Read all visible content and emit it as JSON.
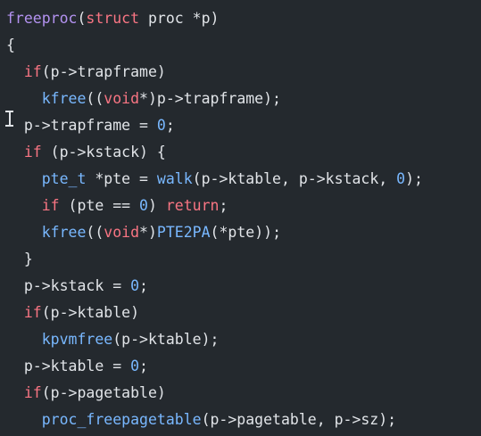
{
  "editor": {
    "colors": {
      "background": "#24292e",
      "text": "#e1e4e8",
      "keyword": "#f97583",
      "function_name": "#b392f0",
      "call": "#79b8ff",
      "number": "#79b8ff"
    },
    "cursor_icon": "text-cursor-ibeam-icon",
    "lines": [
      {
        "tokens": [
          {
            "c": "fn",
            "t": "freeproc"
          },
          {
            "c": "",
            "t": "("
          },
          {
            "c": "kw",
            "t": "struct"
          },
          {
            "c": "",
            "t": " proc *p)"
          }
        ]
      },
      {
        "tokens": [
          {
            "c": "",
            "t": "{"
          }
        ]
      },
      {
        "tokens": [
          {
            "c": "",
            "t": "  "
          },
          {
            "c": "kw",
            "t": "if"
          },
          {
            "c": "",
            "t": "(p->trapframe)"
          }
        ]
      },
      {
        "tokens": [
          {
            "c": "",
            "t": "    "
          },
          {
            "c": "call",
            "t": "kfree"
          },
          {
            "c": "",
            "t": "(("
          },
          {
            "c": "kw",
            "t": "void"
          },
          {
            "c": "",
            "t": "*)p->trapframe);"
          }
        ]
      },
      {
        "tokens": [
          {
            "c": "",
            "t": "  p->trapframe = "
          },
          {
            "c": "num",
            "t": "0"
          },
          {
            "c": "",
            "t": ";"
          }
        ]
      },
      {
        "tokens": [
          {
            "c": "",
            "t": "  "
          },
          {
            "c": "kw",
            "t": "if"
          },
          {
            "c": "",
            "t": " (p->kstack) {"
          }
        ]
      },
      {
        "tokens": [
          {
            "c": "",
            "t": "    "
          },
          {
            "c": "ty",
            "t": "pte_t"
          },
          {
            "c": "",
            "t": " *pte = "
          },
          {
            "c": "call",
            "t": "walk"
          },
          {
            "c": "",
            "t": "(p->ktable, p->kstack, "
          },
          {
            "c": "num",
            "t": "0"
          },
          {
            "c": "",
            "t": ");"
          }
        ]
      },
      {
        "tokens": [
          {
            "c": "",
            "t": "    "
          },
          {
            "c": "kw",
            "t": "if"
          },
          {
            "c": "",
            "t": " (pte == "
          },
          {
            "c": "num",
            "t": "0"
          },
          {
            "c": "",
            "t": ") "
          },
          {
            "c": "kw",
            "t": "return"
          },
          {
            "c": "",
            "t": ";"
          }
        ]
      },
      {
        "tokens": [
          {
            "c": "",
            "t": "    "
          },
          {
            "c": "call",
            "t": "kfree"
          },
          {
            "c": "",
            "t": "(("
          },
          {
            "c": "kw",
            "t": "void"
          },
          {
            "c": "",
            "t": "*)"
          },
          {
            "c": "call",
            "t": "PTE2PA"
          },
          {
            "c": "",
            "t": "(*pte));"
          }
        ]
      },
      {
        "tokens": [
          {
            "c": "",
            "t": "  }"
          }
        ]
      },
      {
        "tokens": [
          {
            "c": "",
            "t": "  p->kstack = "
          },
          {
            "c": "num",
            "t": "0"
          },
          {
            "c": "",
            "t": ";"
          }
        ]
      },
      {
        "tokens": [
          {
            "c": "",
            "t": "  "
          },
          {
            "c": "kw",
            "t": "if"
          },
          {
            "c": "",
            "t": "(p->ktable)"
          }
        ]
      },
      {
        "tokens": [
          {
            "c": "",
            "t": "    "
          },
          {
            "c": "call",
            "t": "kpvmfree"
          },
          {
            "c": "",
            "t": "(p->ktable);"
          }
        ]
      },
      {
        "tokens": [
          {
            "c": "",
            "t": "  p->ktable = "
          },
          {
            "c": "num",
            "t": "0"
          },
          {
            "c": "",
            "t": ";"
          }
        ]
      },
      {
        "tokens": [
          {
            "c": "",
            "t": "  "
          },
          {
            "c": "kw",
            "t": "if"
          },
          {
            "c": "",
            "t": "(p->pagetable)"
          }
        ]
      },
      {
        "tokens": [
          {
            "c": "",
            "t": "    "
          },
          {
            "c": "call",
            "t": "proc_freepagetable"
          },
          {
            "c": "",
            "t": "(p->pagetable, p->sz);"
          }
        ]
      }
    ]
  }
}
